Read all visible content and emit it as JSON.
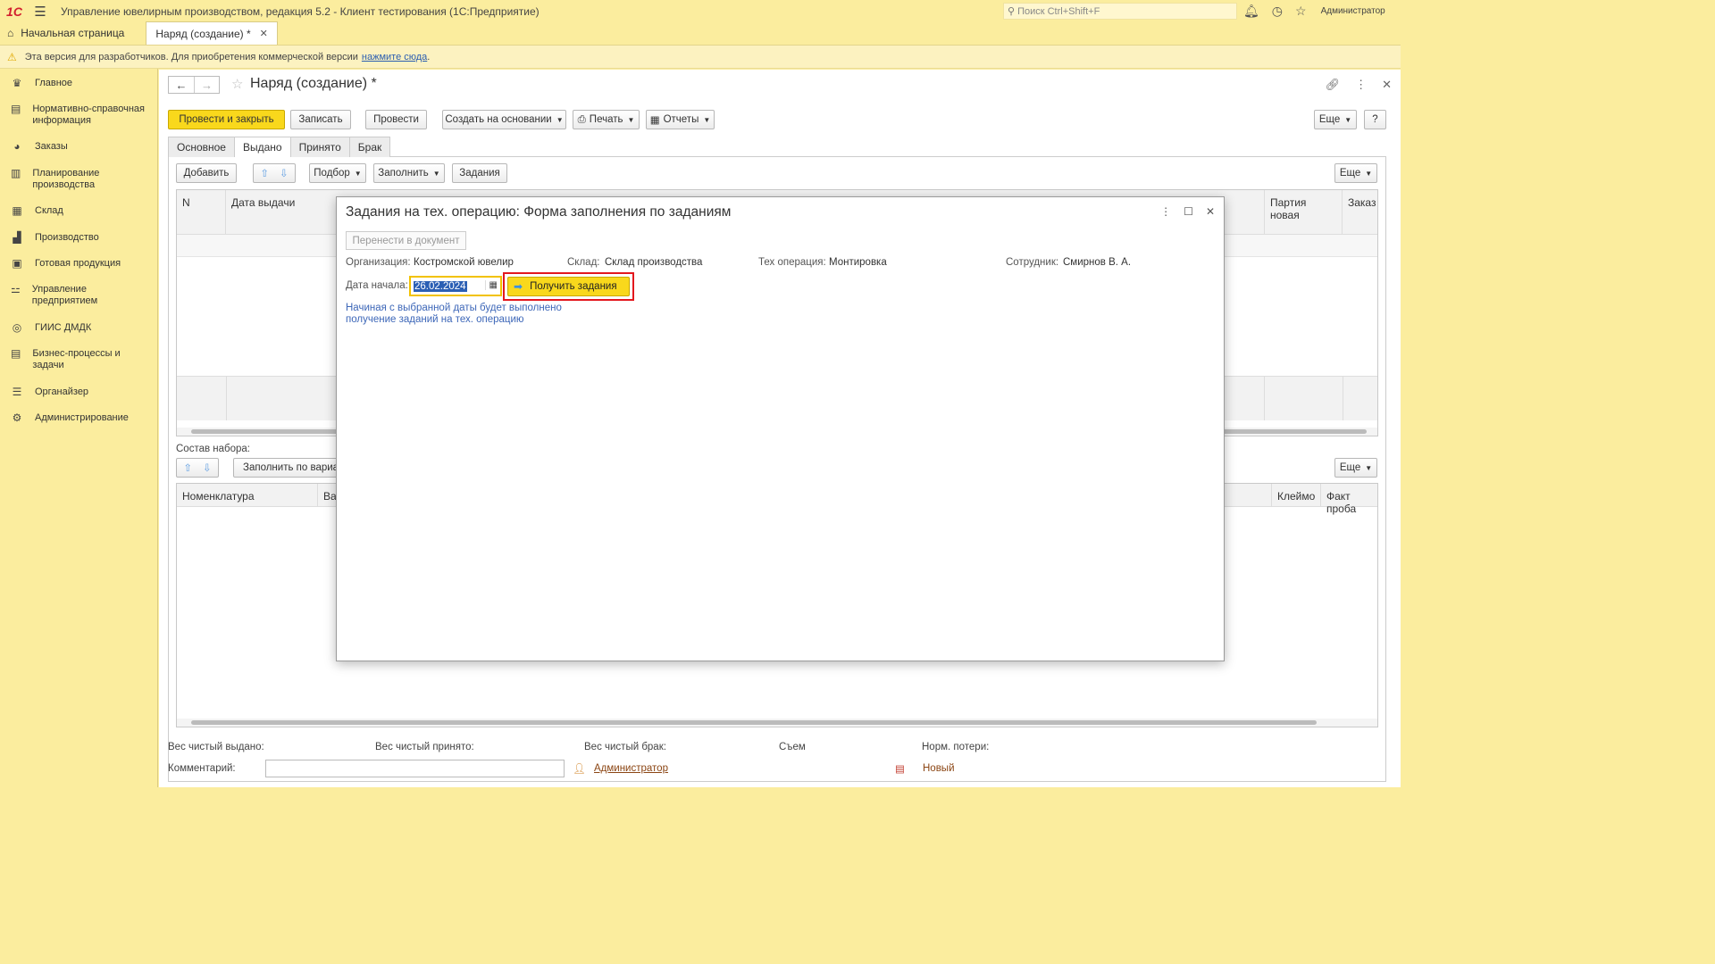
{
  "app": {
    "logo": "1С",
    "title": "Управление ювелирным производством, редакция 5.2  - Клиент тестирования (1С:Предприятие)",
    "search_placeholder": "Поиск Ctrl+Shift+F",
    "user": "Администратор"
  },
  "tabs": [
    {
      "label": "Начальная страница"
    },
    {
      "label": "Наряд (создание) *"
    }
  ],
  "notice": {
    "text": "Эта версия для разработчиков. Для приобретения коммерческой версии",
    "link": "нажмите сюда",
    "tail": "."
  },
  "sidebar": {
    "items": [
      {
        "label": "Главное",
        "icon": "crown-icon"
      },
      {
        "label": "Нормативно-справочная информация",
        "icon": "book-icon"
      },
      {
        "label": "Заказы",
        "icon": "pie-icon"
      },
      {
        "label": "Планирование производства",
        "icon": "clipboard-icon"
      },
      {
        "label": "Склад",
        "icon": "warehouse-icon"
      },
      {
        "label": "Производство",
        "icon": "factory-icon"
      },
      {
        "label": "Готовая продукция",
        "icon": "bag-icon"
      },
      {
        "label": "Управление предприятием",
        "icon": "org-icon"
      },
      {
        "label": "ГИИС ДМДК",
        "icon": "ring-icon"
      },
      {
        "label": "Бизнес-процессы и задачи",
        "icon": "tasks-icon"
      },
      {
        "label": "Органайзер",
        "icon": "organizer-icon"
      },
      {
        "label": "Администрирование",
        "icon": "gear-icon"
      }
    ]
  },
  "form": {
    "title": "Наряд (создание) *",
    "toolbar": {
      "post_close": "Провести и закрыть",
      "save": "Записать",
      "post": "Провести",
      "create_based": "Создать на основании",
      "print": "Печать",
      "reports": "Отчеты",
      "more": "Еще",
      "help": "?"
    },
    "tabs": [
      "Основное",
      "Выдано",
      "Принято",
      "Брак"
    ],
    "issued": {
      "add": "Добавить",
      "selection": "Подбор",
      "fill": "Заполнить",
      "tasks": "Задания",
      "more": "Еще",
      "columns": [
        "N",
        "Дата выдачи",
        "Партия новая",
        "Заказ"
      ]
    },
    "set": {
      "label": "Состав набора:",
      "fill_variant": "Заполнить по вариан",
      "more": "Еще",
      "columns": [
        "Номенклатура",
        "Вар",
        "Клеймо",
        "Факт проба"
      ]
    },
    "footer": {
      "net_issued": "Вес чистый выдано:",
      "net_received": "Вес чистый принято:",
      "net_defect": "Вес чистый брак:",
      "removal": "Съем",
      "norm_loss": "Норм. потери:",
      "comment": "Комментарий:",
      "author": "Администратор",
      "status": "Новый"
    }
  },
  "modal": {
    "title": "Задания на тех. операцию: Форма заполнения по заданиям",
    "transfer_btn": "Перенести в документ",
    "org_label": "Организация:",
    "org_value": "Костромской ювелир",
    "warehouse_label": "Склад:",
    "warehouse_value": "Склад производства",
    "operation_label": "Тех операция:",
    "operation_value": "Монтировка",
    "employee_label": "Сотрудник:",
    "employee_value": "Смирнов В. А.",
    "start_date_label": "Дата начала:",
    "start_date_value": "26.02.2024",
    "get_tasks_btn": "Получить задания",
    "hint": "Начиная с выбранной даты будет выполнено получение заданий на тех. операцию"
  }
}
